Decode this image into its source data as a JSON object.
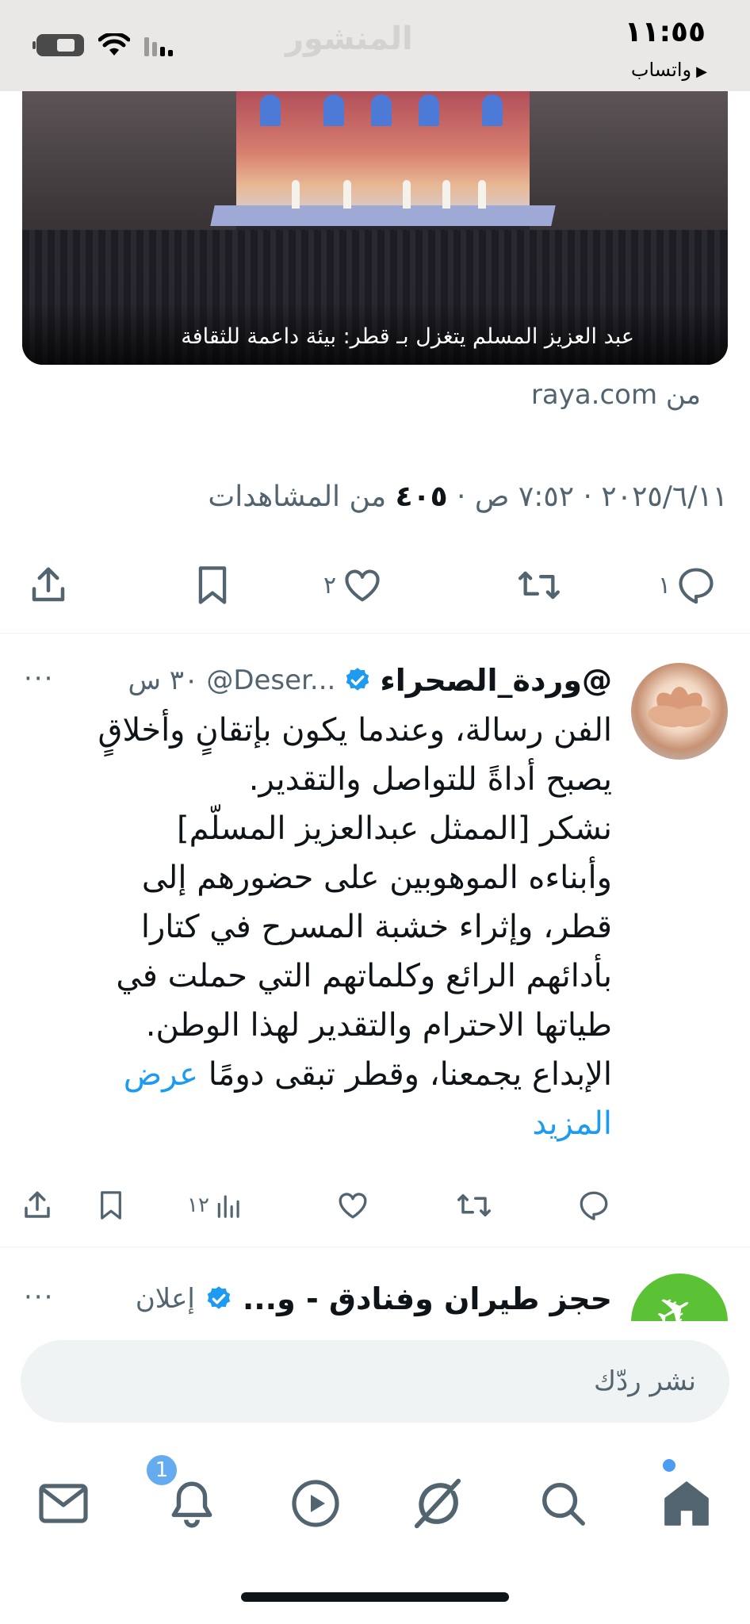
{
  "status_bar": {
    "time": "١١:٥٥",
    "back_app": "واتساب",
    "faded_title": "المنشور"
  },
  "media_card": {
    "caption": "عبد العزيز المسلم يتغزل بـ قطر: بيئة داعمة للثقافة"
  },
  "source": "من raya.com",
  "post_meta": {
    "date": "٢٠٢٥/٦/١١",
    "separator": "·",
    "time": "٧:٥٢ ص",
    "views_count": "٤٠٥",
    "views_label": "من المشاهدات"
  },
  "actions_main": {
    "replies": "١",
    "retweets": "",
    "likes": "٢",
    "bookmarks": "",
    "share": ""
  },
  "reply": {
    "name": "@وردة_الصحراء",
    "handle": "@Deser...",
    "time": "٣٠ س",
    "more": "···",
    "lines": [
      "الفن رسالة، وعندما يكون بإتقانٍ وأخلاقٍ",
      "يصبح أداةً للتواصل والتقدير.",
      "نشكر [الممثل عبدالعزيز المسلّم]",
      "وأبناءه الموهوبين على حضورهم إلى",
      "قطر، وإثراء خشبة المسرح في كتارا",
      "بأدائهم الرائع وكلماتهم التي حملت في",
      "طياتها الاحترام والتقدير لهذا الوطن.",
      "الإبداع يجمعنا، وقطر تبقى دومًا"
    ],
    "show_more_1": "عرض",
    "show_more_2": "المزيد",
    "views": "١٢",
    "replies": "",
    "retweets": "",
    "likes": ""
  },
  "ad": {
    "title": "حجز طيران وفنادق - و...",
    "label": "إعلان",
    "more": "···"
  },
  "composer": {
    "placeholder": "نشر ردّك"
  },
  "nav": {
    "notifications_badge": "1"
  },
  "colors": {
    "accent": "#1d9bf0",
    "muted": "#536471",
    "text": "#0f1419",
    "input_bg": "#eff3f4",
    "status_bg": "#e9e8e6"
  }
}
